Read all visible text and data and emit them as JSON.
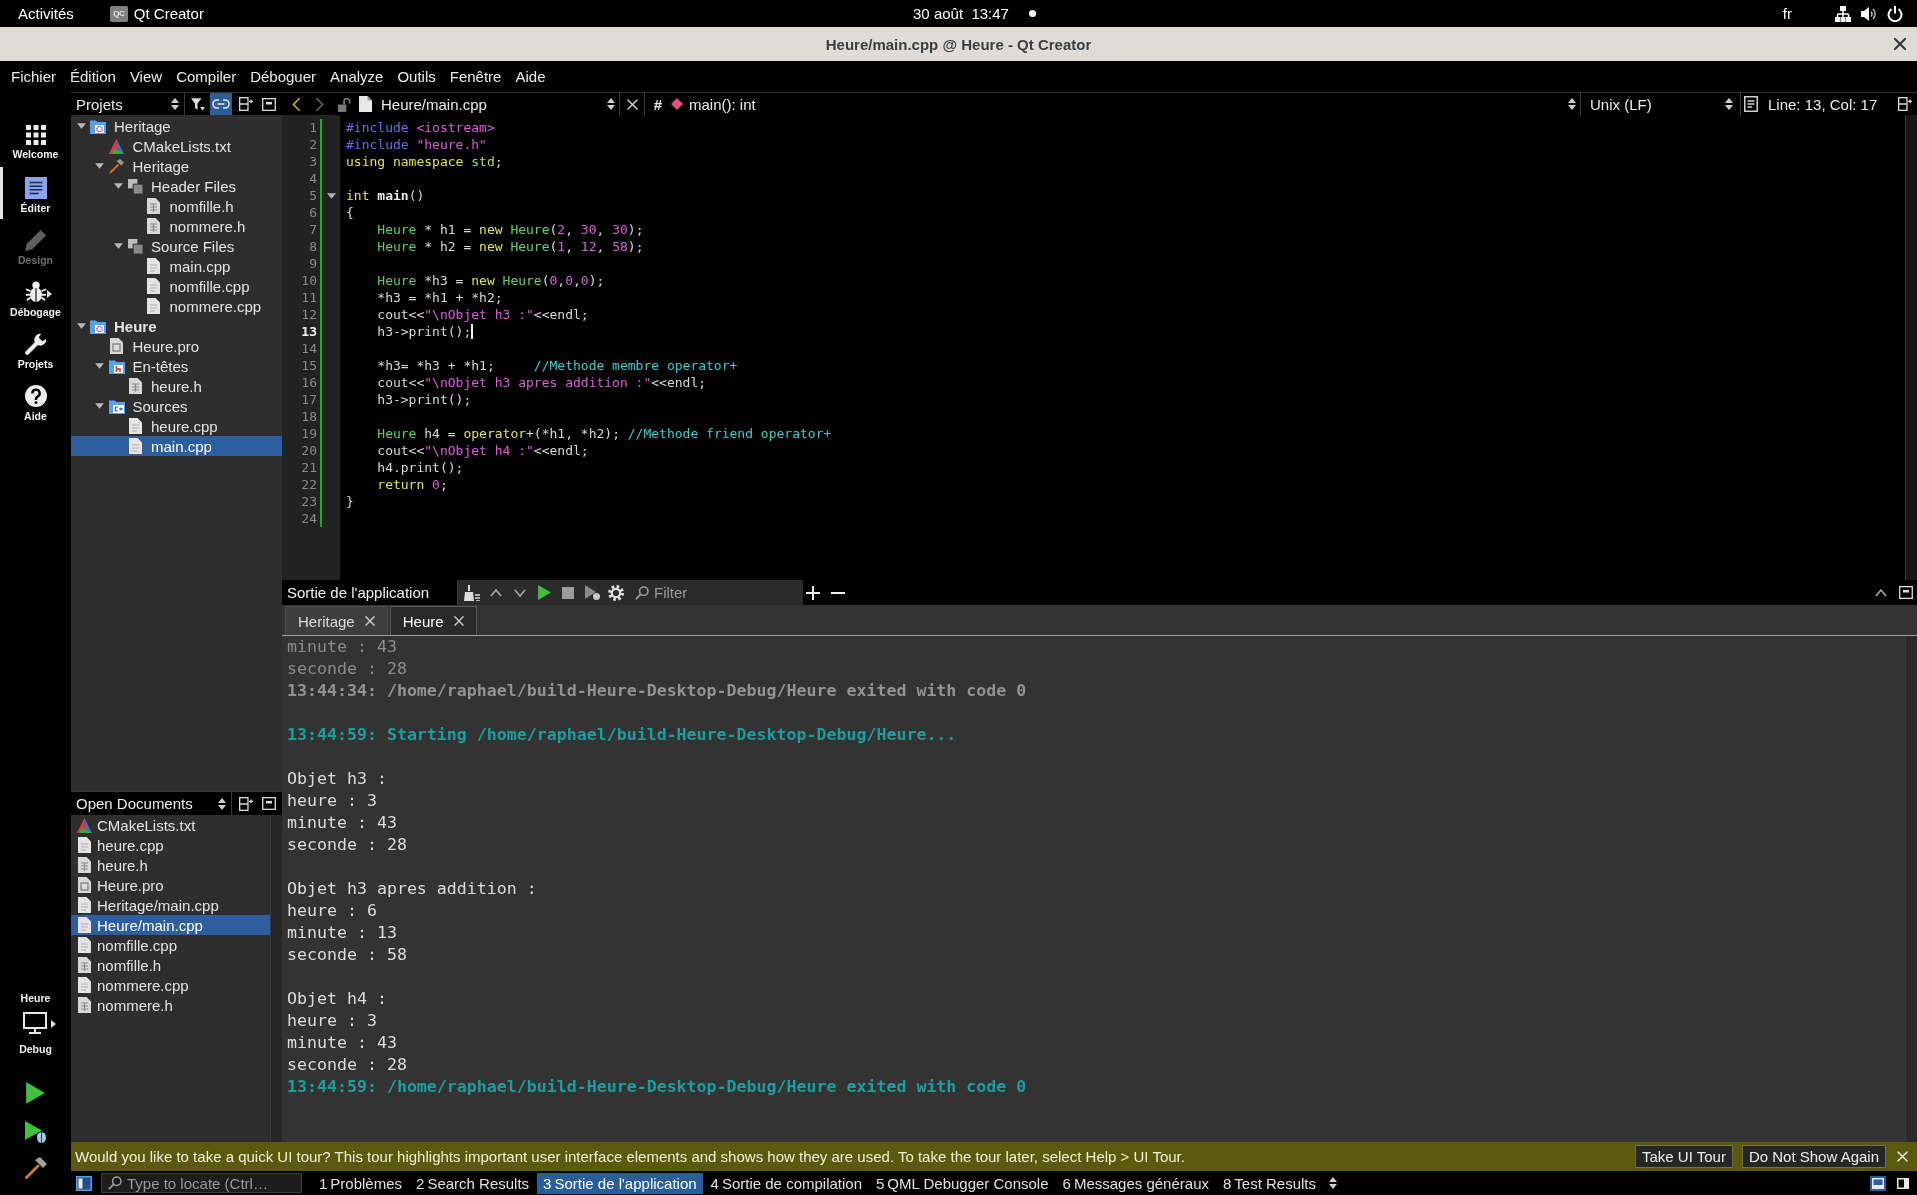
{
  "top_bar": {
    "activities": "Activités",
    "app": {
      "logo_text": "QC",
      "name": "Qt Creator"
    },
    "date": "30 août",
    "time": "13:47",
    "keyboard_layout": "fr"
  },
  "window": {
    "title": "Heure/main.cpp @ Heure - Qt Creator"
  },
  "menu": [
    "Fichier",
    "Édition",
    "View",
    "Compiler",
    "Déboguer",
    "Analyze",
    "Outils",
    "Fenêtre",
    "Aide"
  ],
  "mode_bar": {
    "modes": [
      {
        "kind": "welcome",
        "label": "Welcome",
        "selected": false,
        "disabled": false,
        "submenu": false
      },
      {
        "kind": "edit",
        "label": "Éditer",
        "selected": true,
        "disabled": false,
        "submenu": false
      },
      {
        "kind": "design",
        "label": "Design",
        "selected": false,
        "disabled": true,
        "submenu": false
      },
      {
        "kind": "debug",
        "label": "Débogage",
        "selected": false,
        "disabled": false,
        "submenu": true
      },
      {
        "kind": "projects",
        "label": "Projets",
        "selected": false,
        "disabled": false,
        "submenu": false
      },
      {
        "kind": "help",
        "label": "Aide",
        "selected": false,
        "disabled": false,
        "submenu": false
      }
    ],
    "kit": {
      "project": "Heure",
      "build": "Debug"
    }
  },
  "projects_panel": {
    "title": "Projets",
    "link_toggled": true,
    "tree": [
      {
        "name": "Heritage",
        "kind": "project",
        "active": false,
        "expanded": true,
        "selected": false,
        "children": [
          {
            "name": "CMakeLists.txt",
            "kind": "cmake",
            "active": false,
            "selected": false
          },
          {
            "name": "Heritage",
            "kind": "target",
            "active": false,
            "expanded": true,
            "selected": false,
            "children": [
              {
                "name": "Header Files",
                "kind": "group",
                "active": false,
                "expanded": true,
                "selected": false,
                "children": [
                  {
                    "name": "nomfille.h",
                    "kind": "header",
                    "active": false,
                    "selected": false
                  },
                  {
                    "name": "nommere.h",
                    "kind": "header",
                    "active": false,
                    "selected": false
                  }
                ]
              },
              {
                "name": "Source Files",
                "kind": "group",
                "active": false,
                "expanded": true,
                "selected": false,
                "children": [
                  {
                    "name": "main.cpp",
                    "kind": "source",
                    "active": false,
                    "selected": false
                  },
                  {
                    "name": "nomfille.cpp",
                    "kind": "source",
                    "active": false,
                    "selected": false
                  },
                  {
                    "name": "nommere.cpp",
                    "kind": "source",
                    "active": false,
                    "selected": false
                  }
                ]
              }
            ]
          }
        ]
      },
      {
        "name": "Heure",
        "kind": "project",
        "active": true,
        "expanded": true,
        "selected": false,
        "children": [
          {
            "name": "Heure.pro",
            "kind": "qmake",
            "active": false,
            "selected": false
          },
          {
            "name": "En-têtes",
            "kind": "header-folder",
            "active": false,
            "expanded": true,
            "selected": false,
            "children": [
              {
                "name": "heure.h",
                "kind": "header",
                "active": false,
                "selected": false
              }
            ]
          },
          {
            "name": "Sources",
            "kind": "source-folder",
            "active": false,
            "expanded": true,
            "selected": false,
            "children": [
              {
                "name": "heure.cpp",
                "kind": "source",
                "active": false,
                "selected": false
              },
              {
                "name": "main.cpp",
                "kind": "source",
                "active": false,
                "selected": true
              }
            ]
          }
        ]
      }
    ]
  },
  "editor": {
    "toolbar": {
      "back": {
        "disabled": false
      },
      "forward": {
        "disabled": true
      },
      "file": "Heure/main.cpp",
      "hash": "#",
      "symbol": "main(): int",
      "line_ending": "Unix (LF)",
      "position": "Line: 13, Col: 17"
    },
    "lines": [
      {
        "number": "1",
        "current": false,
        "fold_marker": false,
        "tokens": [
          {
            "kind": "preprocessor",
            "text": "#include "
          },
          {
            "kind": "string",
            "text": "<iostream>"
          }
        ]
      },
      {
        "number": "2",
        "current": false,
        "fold_marker": false,
        "tokens": [
          {
            "kind": "preprocessor",
            "text": "#include "
          },
          {
            "kind": "string",
            "text": "\"heure.h\""
          }
        ]
      },
      {
        "number": "3",
        "current": false,
        "fold_marker": false,
        "tokens": [
          {
            "kind": "keyword",
            "text": "using namespace "
          },
          {
            "kind": "namespace",
            "text": "std"
          },
          {
            "kind": "plain",
            "text": ";"
          }
        ]
      },
      {
        "number": "4",
        "current": false,
        "fold_marker": false
      },
      {
        "number": "5",
        "current": false,
        "fold_marker": true,
        "tokens": [
          {
            "kind": "keyword",
            "text": "int "
          },
          {
            "kind": "function",
            "text": "main"
          },
          {
            "kind": "plain",
            "text": "()"
          }
        ]
      },
      {
        "number": "6",
        "current": false,
        "fold_marker": false,
        "tokens": [
          {
            "kind": "plain",
            "text": "{"
          }
        ]
      },
      {
        "number": "7",
        "current": false,
        "fold_marker": false,
        "tokens": [
          {
            "kind": "type",
            "text": "    Heure"
          },
          {
            "kind": "plain",
            "text": " * h1 = "
          },
          {
            "kind": "keyword",
            "text": "new "
          },
          {
            "kind": "type",
            "text": "Heure"
          },
          {
            "kind": "plain",
            "text": "("
          },
          {
            "kind": "number",
            "text": "2"
          },
          {
            "kind": "plain",
            "text": ", "
          },
          {
            "kind": "number",
            "text": "30"
          },
          {
            "kind": "plain",
            "text": ", "
          },
          {
            "kind": "number",
            "text": "30"
          },
          {
            "kind": "plain",
            "text": ");"
          }
        ]
      },
      {
        "number": "8",
        "current": false,
        "fold_marker": false,
        "tokens": [
          {
            "kind": "type",
            "text": "    Heure"
          },
          {
            "kind": "plain",
            "text": " * h2 = "
          },
          {
            "kind": "keyword",
            "text": "new "
          },
          {
            "kind": "type",
            "text": "Heure"
          },
          {
            "kind": "plain",
            "text": "("
          },
          {
            "kind": "number",
            "text": "1"
          },
          {
            "kind": "plain",
            "text": ", "
          },
          {
            "kind": "number",
            "text": "12"
          },
          {
            "kind": "plain",
            "text": ", "
          },
          {
            "kind": "number",
            "text": "58"
          },
          {
            "kind": "plain",
            "text": ");"
          }
        ]
      },
      {
        "number": "9",
        "current": false,
        "fold_marker": false
      },
      {
        "number": "10",
        "current": false,
        "fold_marker": false,
        "tokens": [
          {
            "kind": "type",
            "text": "    Heure"
          },
          {
            "kind": "plain",
            "text": " *h3 = "
          },
          {
            "kind": "keyword",
            "text": "new "
          },
          {
            "kind": "type",
            "text": "Heure"
          },
          {
            "kind": "plain",
            "text": "("
          },
          {
            "kind": "number",
            "text": "0"
          },
          {
            "kind": "plain",
            "text": ","
          },
          {
            "kind": "number",
            "text": "0"
          },
          {
            "kind": "plain",
            "text": ","
          },
          {
            "kind": "number",
            "text": "0"
          },
          {
            "kind": "plain",
            "text": ");"
          }
        ]
      },
      {
        "number": "11",
        "current": false,
        "fold_marker": false,
        "tokens": [
          {
            "kind": "plain",
            "text": "    *h3 = *h1 + *h2;"
          }
        ]
      },
      {
        "number": "12",
        "current": false,
        "fold_marker": false,
        "tokens": [
          {
            "kind": "plain",
            "text": "    cout<<"
          },
          {
            "kind": "string",
            "text": "\"\\nObjet h3 :\""
          },
          {
            "kind": "plain",
            "text": "<<endl;"
          }
        ]
      },
      {
        "number": "13",
        "current": true,
        "fold_marker": false,
        "tokens": [
          {
            "kind": "plain",
            "text": "    h3->print();"
          }
        ]
      },
      {
        "number": "14",
        "current": false,
        "fold_marker": false
      },
      {
        "number": "15",
        "current": false,
        "fold_marker": false,
        "tokens": [
          {
            "kind": "plain",
            "text": "    *h3= *h3 + *h1;     "
          },
          {
            "kind": "comment",
            "text": "//Methode membre operator+"
          }
        ]
      },
      {
        "number": "16",
        "current": false,
        "fold_marker": false,
        "tokens": [
          {
            "kind": "plain",
            "text": "    cout<<"
          },
          {
            "kind": "string",
            "text": "\"\\nObjet h3 apres addition :\""
          },
          {
            "kind": "plain",
            "text": "<<endl;"
          }
        ]
      },
      {
        "number": "17",
        "current": false,
        "fold_marker": false,
        "tokens": [
          {
            "kind": "plain",
            "text": "    h3->print();"
          }
        ]
      },
      {
        "number": "18",
        "current": false,
        "fold_marker": false
      },
      {
        "number": "19",
        "current": false,
        "fold_marker": false,
        "tokens": [
          {
            "kind": "type",
            "text": "    Heure"
          },
          {
            "kind": "plain",
            "text": " h4 = "
          },
          {
            "kind": "keyword",
            "text": "operator"
          },
          {
            "kind": "plain",
            "text": "+(*h1, *h2); "
          },
          {
            "kind": "comment",
            "text": "//Methode friend operator+"
          }
        ]
      },
      {
        "number": "20",
        "current": false,
        "fold_marker": false,
        "tokens": [
          {
            "kind": "plain",
            "text": "    cout<<"
          },
          {
            "kind": "string",
            "text": "\"\\nObjet h4 :\""
          },
          {
            "kind": "plain",
            "text": "<<endl;"
          }
        ]
      },
      {
        "number": "21",
        "current": false,
        "fold_marker": false,
        "tokens": [
          {
            "kind": "plain",
            "text": "    h4.print();"
          }
        ]
      },
      {
        "number": "22",
        "current": false,
        "fold_marker": false,
        "tokens": [
          {
            "kind": "keyword",
            "text": "    return "
          },
          {
            "kind": "number",
            "text": "0"
          },
          {
            "kind": "plain",
            "text": ";"
          }
        ]
      },
      {
        "number": "23",
        "current": false,
        "fold_marker": false,
        "tokens": [
          {
            "kind": "plain",
            "text": "}"
          }
        ]
      },
      {
        "number": "24",
        "current": false,
        "fold_marker": false
      }
    ]
  },
  "open_documents": {
    "title": "Open Documents",
    "items": [
      {
        "name": "CMakeLists.txt",
        "kind": "cmake",
        "selected": false
      },
      {
        "name": "heure.cpp",
        "kind": "source",
        "selected": false
      },
      {
        "name": "heure.h",
        "kind": "header",
        "selected": false
      },
      {
        "name": "Heure.pro",
        "kind": "qmake",
        "selected": false
      },
      {
        "name": "Heritage/main.cpp",
        "kind": "source",
        "selected": false
      },
      {
        "name": "Heure/main.cpp",
        "kind": "source",
        "selected": true
      },
      {
        "name": "nomfille.cpp",
        "kind": "source",
        "selected": false
      },
      {
        "name": "nomfille.h",
        "kind": "header",
        "selected": false
      },
      {
        "name": "nommere.cpp",
        "kind": "source",
        "selected": false
      },
      {
        "name": "nommere.h",
        "kind": "header",
        "selected": false
      }
    ]
  },
  "output_pane": {
    "title": "Sortie de l'application",
    "filter_placeholder": "Filter",
    "tabs": [
      {
        "label": "Heritage",
        "selected": false
      },
      {
        "label": "Heure",
        "selected": true
      }
    ],
    "lines": [
      {
        "kind": "previous",
        "text": "minute : 43"
      },
      {
        "kind": "previous",
        "text": "seconde : 28"
      },
      {
        "kind": "previous-status",
        "text": "13:44:34: /home/raphael/build-Heure-Desktop-Debug/Heure exited with code 0"
      },
      {
        "kind": "gap"
      },
      {
        "kind": "status",
        "text": "13:44:59: Starting /home/raphael/build-Heure-Desktop-Debug/Heure..."
      },
      {
        "kind": "gap"
      },
      {
        "kind": "output",
        "text": "Objet h3 :"
      },
      {
        "kind": "output",
        "text": "heure : 3"
      },
      {
        "kind": "output",
        "text": "minute : 43"
      },
      {
        "kind": "output",
        "text": "seconde : 28"
      },
      {
        "kind": "gap"
      },
      {
        "kind": "output",
        "text": "Objet h3 apres addition :"
      },
      {
        "kind": "output",
        "text": "heure : 6"
      },
      {
        "kind": "output",
        "text": "minute : 13"
      },
      {
        "kind": "output",
        "text": "seconde : 58"
      },
      {
        "kind": "gap"
      },
      {
        "kind": "output",
        "text": "Objet h4 :"
      },
      {
        "kind": "output",
        "text": "heure : 3"
      },
      {
        "kind": "output",
        "text": "minute : 43"
      },
      {
        "kind": "output",
        "text": "seconde : 28"
      },
      {
        "kind": "status",
        "text": "13:44:59: /home/raphael/build-Heure-Desktop-Debug/Heure exited with code 0"
      }
    ]
  },
  "tour_bar": {
    "message": "Would you like to take a quick UI tour? This tour highlights important user interface elements and shows how they are used. To take the tour later, select Help > UI Tour.",
    "buttons": [
      "Take UI Tour",
      "Do Not Show Again"
    ]
  },
  "status_bar": {
    "locator_placeholder": "Type to locate (Ctrl…",
    "panes": [
      {
        "number": "1",
        "label": "Problèmes",
        "selected": false
      },
      {
        "number": "2",
        "label": "Search Results",
        "selected": false
      },
      {
        "number": "3",
        "label": "Sortie de l'application",
        "selected": true
      },
      {
        "number": "4",
        "label": "Sortie de compilation",
        "selected": false
      },
      {
        "number": "5",
        "label": "QML Debugger Console",
        "selected": false
      },
      {
        "number": "6",
        "label": "Messages généraux",
        "selected": false
      },
      {
        "number": "8",
        "label": "Test Results",
        "selected": false
      }
    ]
  }
}
